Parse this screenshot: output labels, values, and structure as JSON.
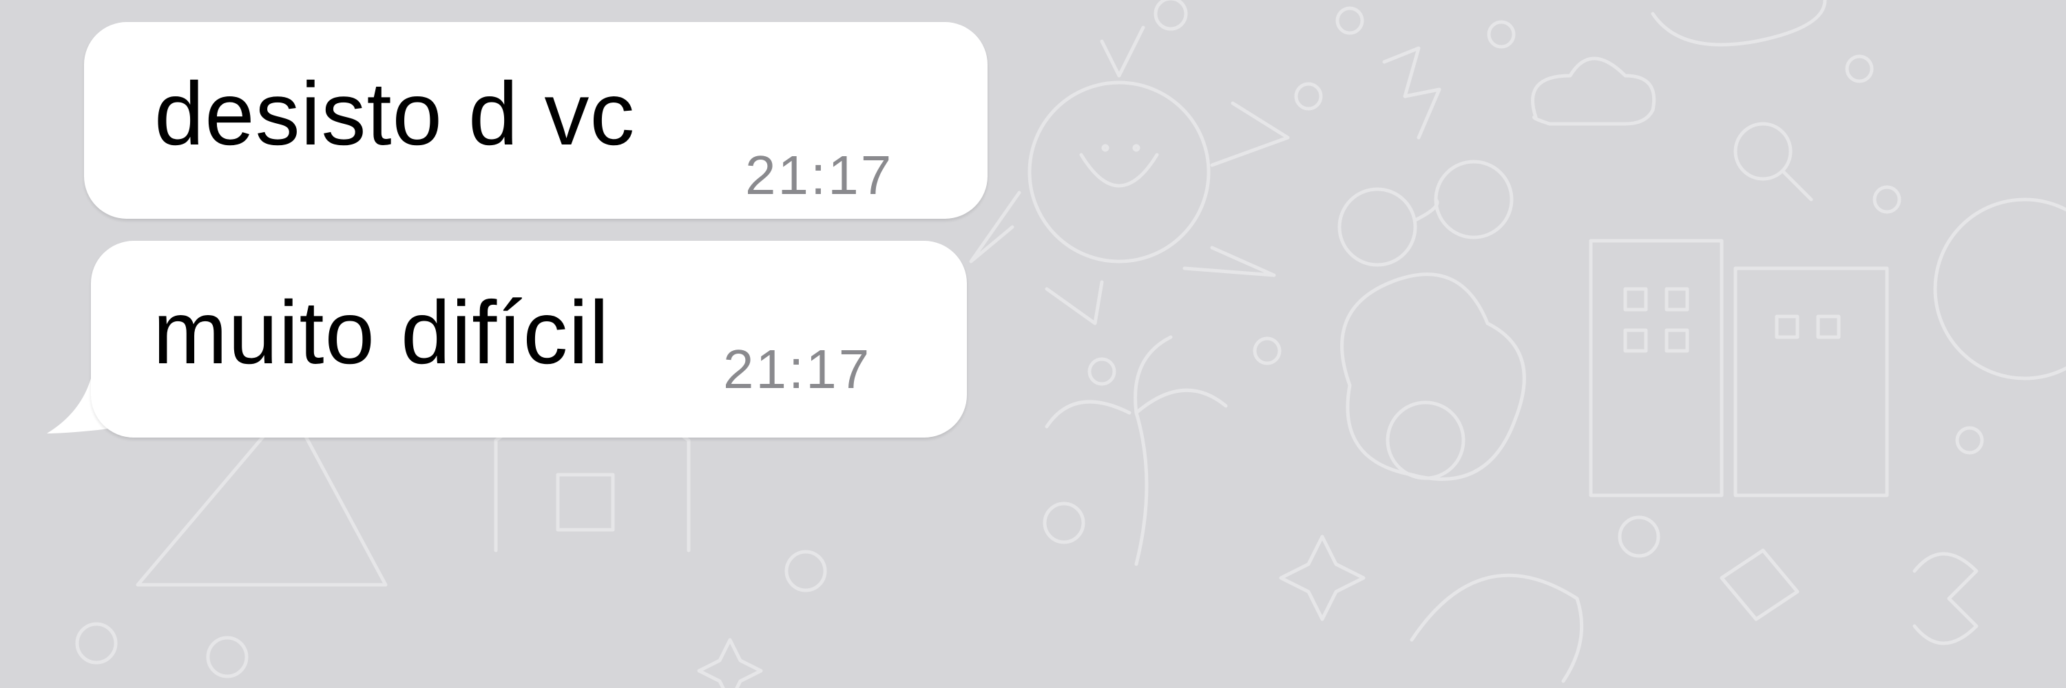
{
  "chat": {
    "background_color": "#d6d6d9",
    "bubble_color": "#ffffff",
    "messages": [
      {
        "text": "desisto d vc",
        "time": "21:17",
        "direction": "incoming"
      },
      {
        "text": "muito difícil",
        "time": "21:17",
        "direction": "incoming"
      }
    ]
  }
}
